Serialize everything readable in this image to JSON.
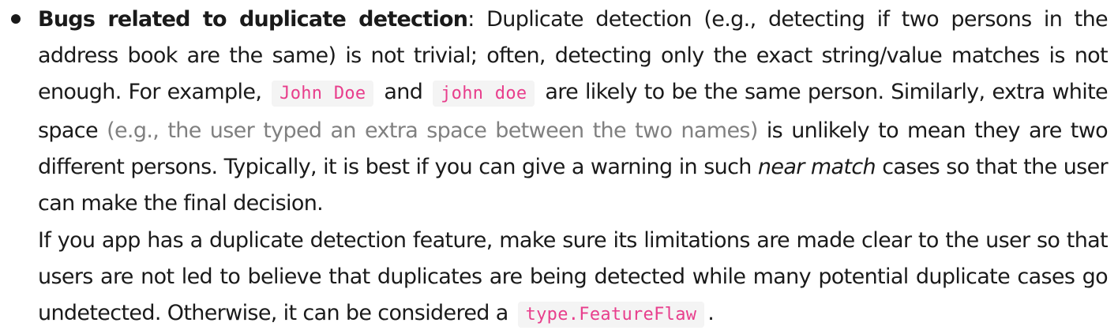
{
  "item": {
    "heading": "Bugs related to duplicate detection",
    "colon": ":",
    "p1_text1": " Duplicate detection (e.g., detecting if two persons in the address book are the same) is not trivial; often, detecting only the exact string/value matches is not enough. For example, ",
    "code_john_upper": "John Doe",
    "p1_and": " and ",
    "code_john_lower": "john doe",
    "p1_text2": " are likely to be the same person. Similarly, extra white space ",
    "p1_muted": "(e.g., the user typed an extra space between the two names)",
    "p1_text3": " is unlikely to mean they are two different persons. Typically, it is best if you can give a warning in such ",
    "p1_em": "near match",
    "p1_text4": " cases so that the user can make the final decision.",
    "p2_text1": "If you app has a duplicate detection feature, make sure its limitations are made clear to the user so that users are not led to believe that duplicates are being detected while many potential duplicate cases go undetected. Otherwise, it can be considered a ",
    "code_label": "type.FeatureFlaw",
    "p2_end": "."
  },
  "colors": {
    "text": "#1a1a1a",
    "muted": "#808080",
    "code_text": "#e83e8c",
    "code_bg": "#f4f4f4"
  }
}
